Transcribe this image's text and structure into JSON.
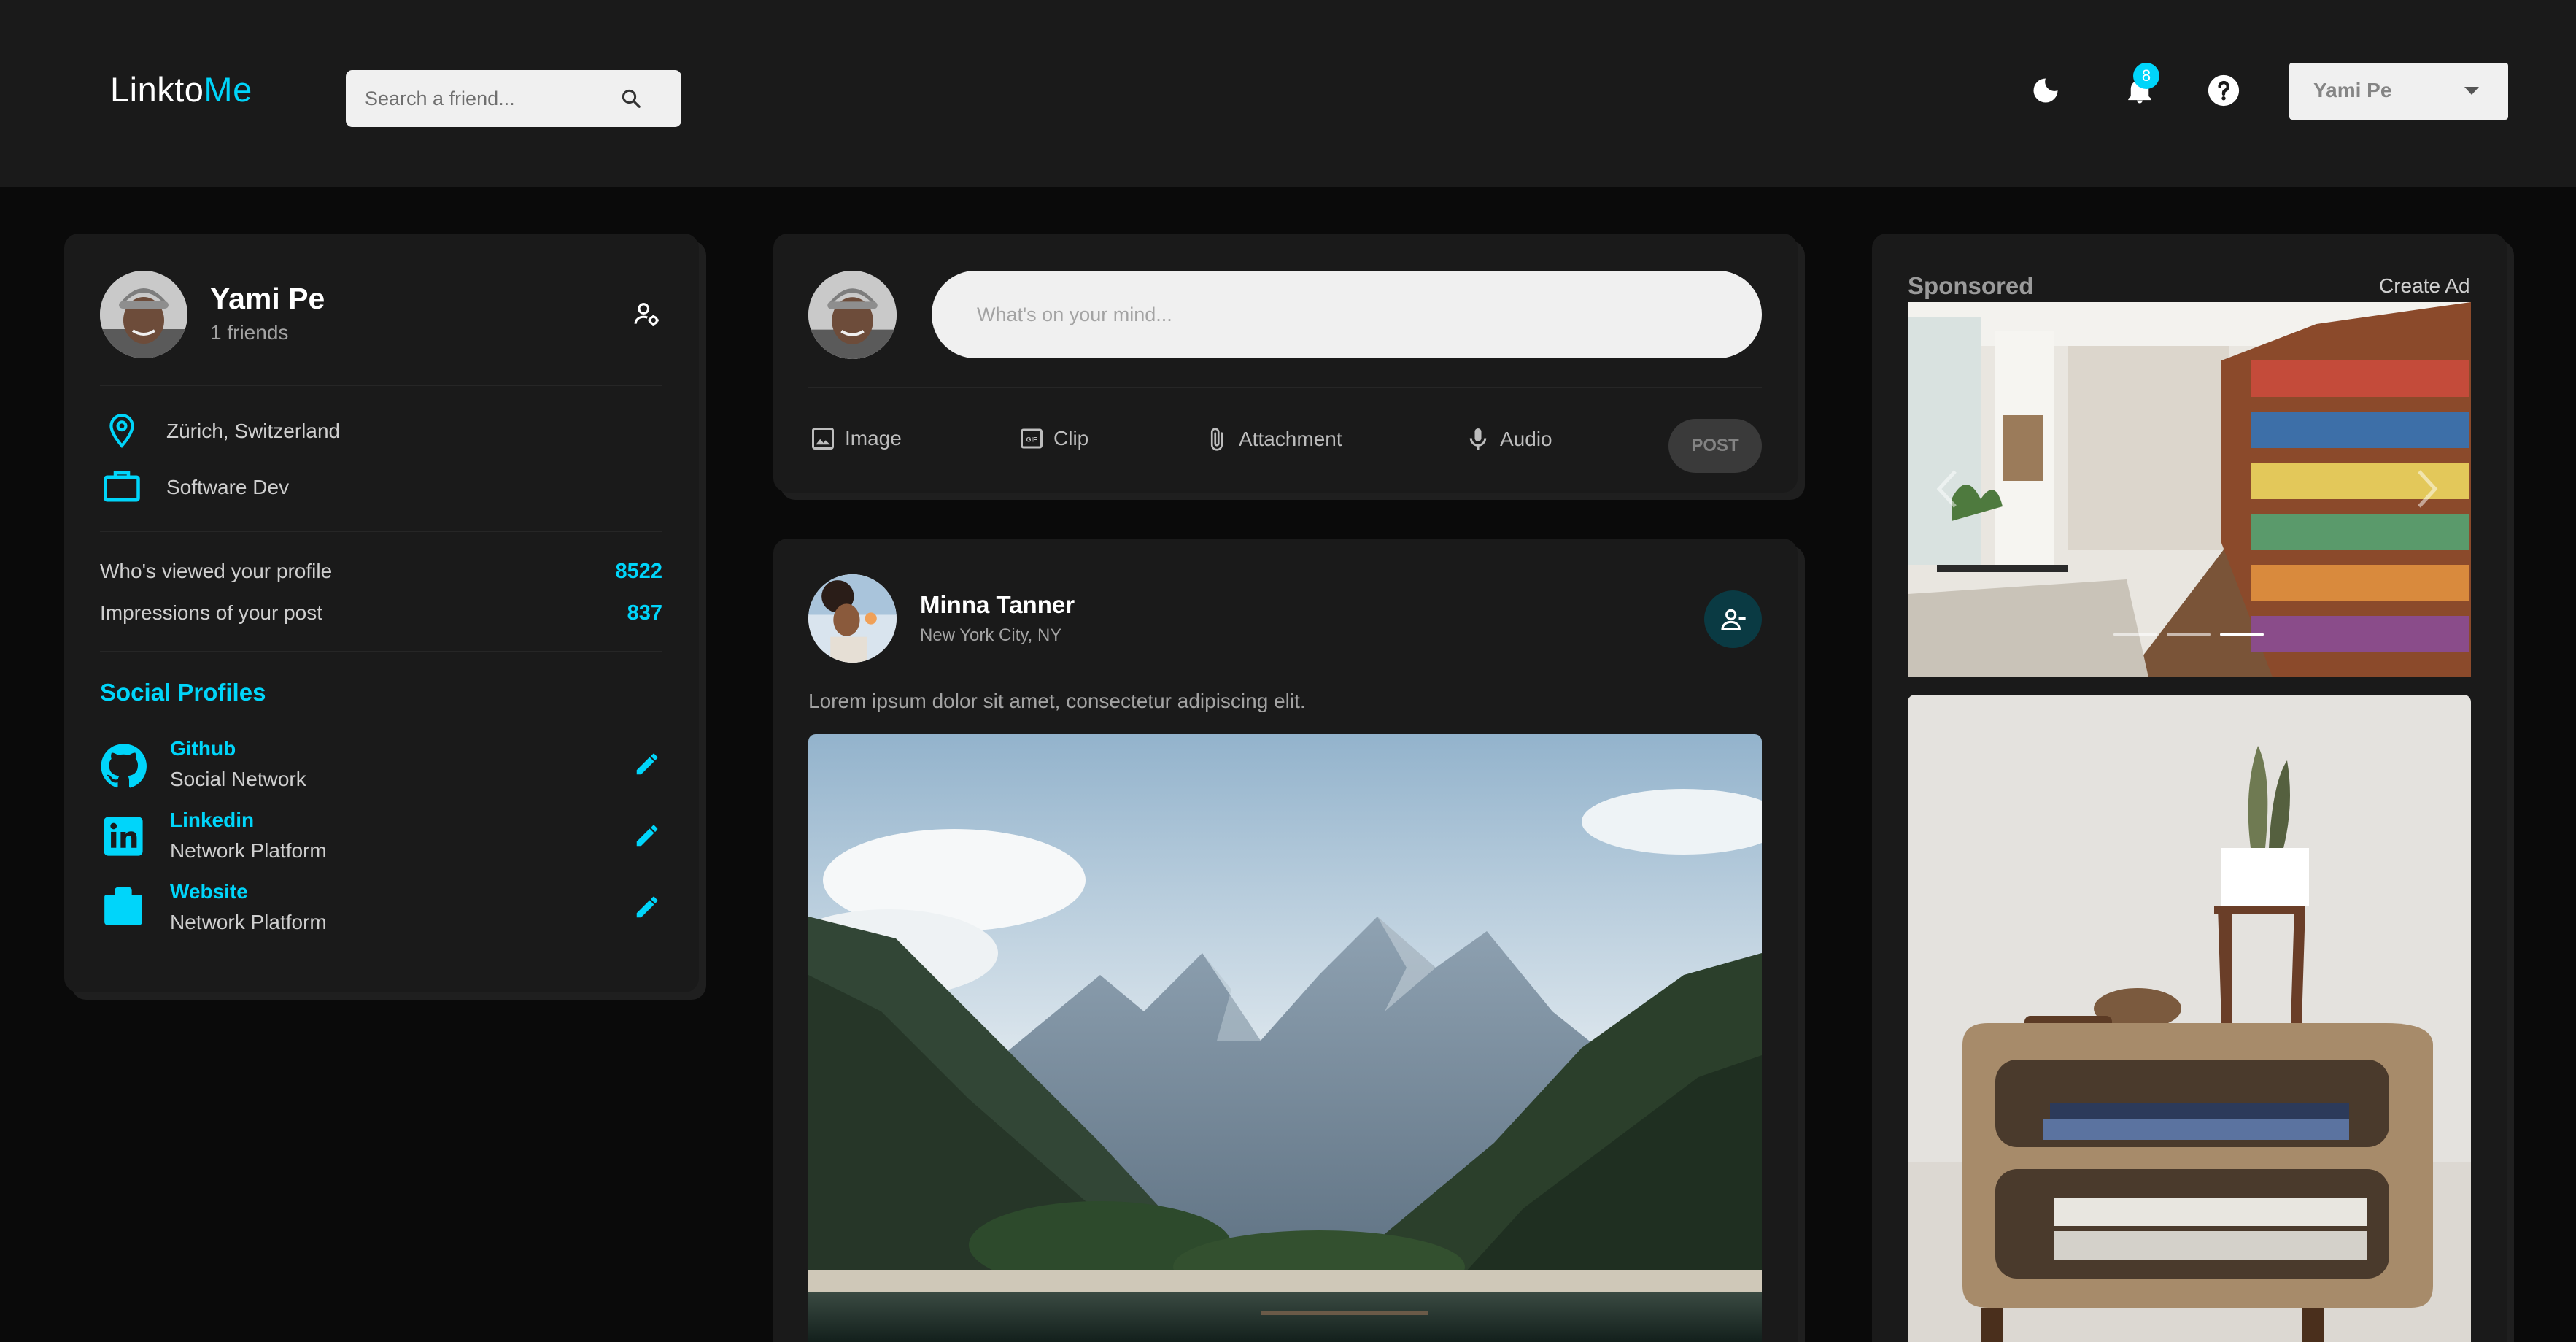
{
  "app": {
    "logo_part1": "Linkto",
    "logo_part2": "Me",
    "accent_color": "#00d5fa"
  },
  "header": {
    "search_placeholder": "Search a friend...",
    "notification_count": "8",
    "user_name": "Yami Pe",
    "icons": [
      "moon-icon",
      "bell-icon",
      "help-icon",
      "search-icon",
      "caret-down-icon"
    ]
  },
  "profile": {
    "name": "Yami Pe",
    "friends": "1 friends",
    "location": "Zürich, Switzerland",
    "occupation": "Software Dev",
    "stats": [
      {
        "label": "Who's viewed your profile",
        "value": "8522"
      },
      {
        "label": "Impressions of your post",
        "value": "837"
      }
    ],
    "social_title": "Social Profiles",
    "socials": [
      {
        "name": "Github",
        "sub": "Social Network",
        "icon": "github-icon"
      },
      {
        "name": "Linkedin",
        "sub": "Network Platform",
        "icon": "linkedin-icon"
      },
      {
        "name": "Website",
        "sub": "Network Platform",
        "icon": "briefcase-icon"
      }
    ]
  },
  "composer": {
    "placeholder": "What's on your mind...",
    "tools": [
      {
        "label": "Image",
        "icon": "image-icon"
      },
      {
        "label": "Clip",
        "icon": "gif-icon"
      },
      {
        "label": "Attachment",
        "icon": "paperclip-icon"
      },
      {
        "label": "Audio",
        "icon": "microphone-icon"
      }
    ],
    "post_label": "POST"
  },
  "post": {
    "author": "Minna Tanner",
    "location": "New York City, NY",
    "text": "Lorem ipsum dolor sit amet, consectetur adipiscing elit."
  },
  "sponsored": {
    "label": "Sponsored",
    "create_label": "Create Ad",
    "carousel_active_index": 2,
    "carousel_count": 3
  }
}
